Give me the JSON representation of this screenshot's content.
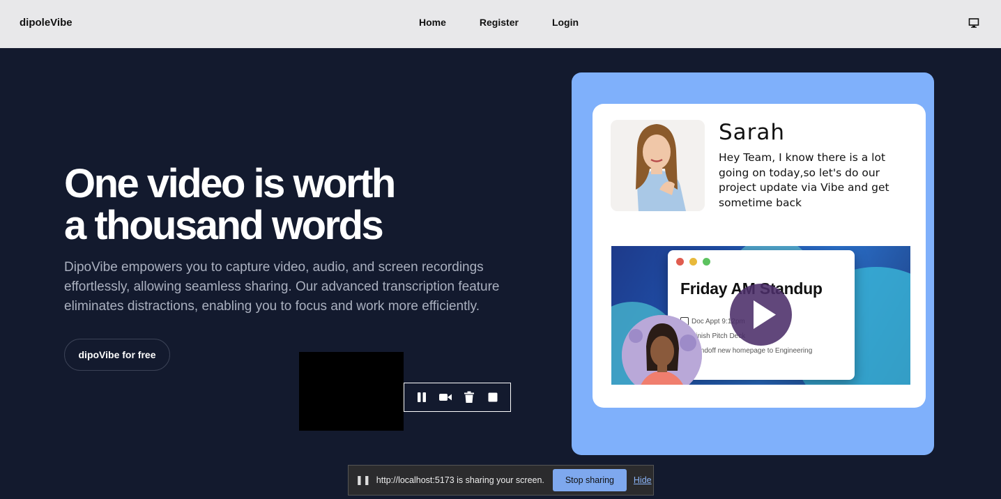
{
  "nav": {
    "brand": "dipoleVibe",
    "links": [
      "Home",
      "Register",
      "Login"
    ],
    "right_icon": "monitor-icon"
  },
  "hero": {
    "title_line1": "One video is worth",
    "title_line2": "a thousand words",
    "description": "DipoVibe empowers you to capture video, audio, and screen recordings effortlessly, allowing seamless sharing. Our advanced transcription feature eliminates distractions, enabling you to focus and work more efficiently.",
    "cta_label": "dipoVibe for free"
  },
  "recorder": {
    "icons": [
      "pause-icon",
      "video-camera-icon",
      "trash-icon",
      "stop-icon"
    ]
  },
  "card": {
    "name": "Sarah",
    "message": "Hey Team, I know there is a lot going on today,so let's do our project update via Vibe and get sometime back",
    "video": {
      "title": "Friday AM Standup",
      "items": [
        "Doc Appt 9:12pm",
        "Finish Pitch Deck",
        "Handoff new homepage to Engineering"
      ]
    }
  },
  "share_bar": {
    "text": "http://localhost:5173 is sharing your screen.",
    "stop_label": "Stop sharing",
    "hide_label": "Hide"
  },
  "colors": {
    "nav_bg": "#e8e8ea",
    "page_bg": "#131a2e",
    "panel_blue": "#7fb0fb",
    "play_purple": "#4b2d69",
    "stop_btn": "#7ea8ee"
  }
}
